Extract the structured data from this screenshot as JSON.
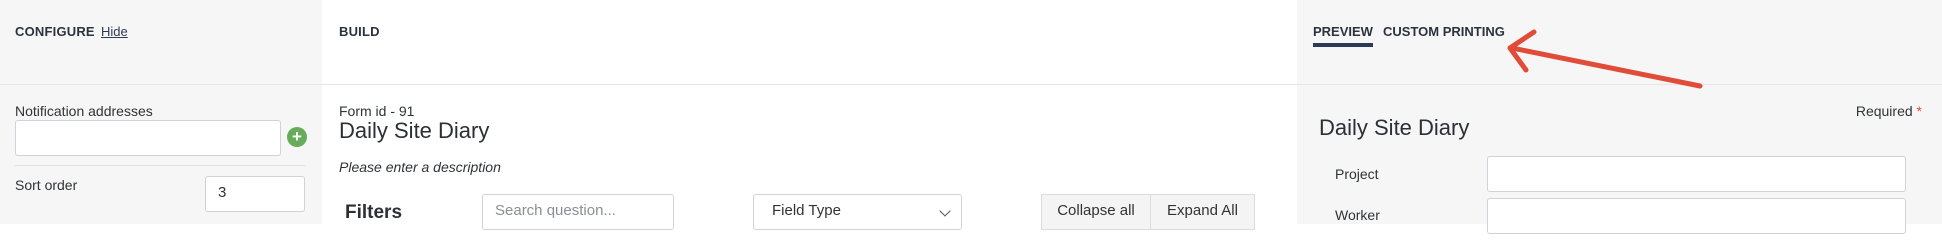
{
  "configure": {
    "heading": "CONFIGURE",
    "hide_link": "Hide",
    "notification_label": "Notification addresses",
    "notification_value": "",
    "sort_order_label": "Sort order",
    "sort_order_value": "3"
  },
  "build": {
    "heading": "BUILD",
    "form_id": "Form id - 91",
    "form_title": "Daily Site Diary",
    "description": "Please enter a description",
    "filters_label": "Filters",
    "search_placeholder": "Search question...",
    "field_type_selected": "Field Type",
    "collapse_all": "Collapse all",
    "expand_all": "Expand All"
  },
  "preview_panel": {
    "tabs": [
      {
        "label": "PREVIEW",
        "active": true
      },
      {
        "label": "CUSTOM PRINTING",
        "active": false
      }
    ],
    "required_label": "Required",
    "required_star": "*",
    "title": "Daily Site Diary",
    "fields": [
      {
        "label": "Project",
        "value": ""
      },
      {
        "label": "Worker",
        "value": ""
      }
    ]
  },
  "colors": {
    "accent_underline": "#2b3a57",
    "add_icon": "#67ac5b",
    "annotation_arrow": "#e04b3a",
    "required_star": "#e04b3a"
  },
  "icons": {
    "add": "plus-circle-icon",
    "dropdown": "chevron-down-icon",
    "annotation": "red-arrow"
  }
}
